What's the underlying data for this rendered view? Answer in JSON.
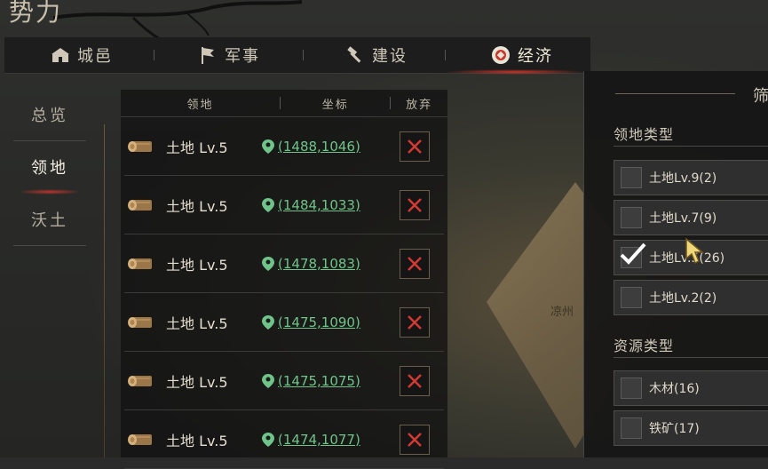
{
  "page_title": "势力",
  "tabs": [
    {
      "label": "城邑",
      "icon": "city-icon",
      "active": false
    },
    {
      "label": "军事",
      "icon": "flag-icon",
      "active": false
    },
    {
      "label": "建设",
      "icon": "hammer-icon",
      "active": false
    },
    {
      "label": "经济",
      "icon": "coin-icon",
      "active": true
    }
  ],
  "nav": [
    {
      "label": "总览",
      "active": false
    },
    {
      "label": "领地",
      "active": true
    },
    {
      "label": "沃土",
      "active": false
    }
  ],
  "table": {
    "headers": {
      "land": "领地",
      "coord": "坐标",
      "abandon": "放弃"
    },
    "rows": [
      {
        "name": "土地 Lv.5",
        "coord": "(1488,1046)"
      },
      {
        "name": "土地 Lv.5",
        "coord": "(1484,1033)"
      },
      {
        "name": "土地 Lv.5",
        "coord": "(1478,1083)"
      },
      {
        "name": "土地 Lv.5",
        "coord": "(1475,1090)"
      },
      {
        "name": "土地 Lv.5",
        "coord": "(1475,1075)"
      },
      {
        "name": "土地 Lv.5",
        "coord": "(1474,1077)"
      }
    ]
  },
  "map": {
    "label": "凉州"
  },
  "filter": {
    "title": "筛",
    "land_type_title": "领地类型",
    "land_options": [
      {
        "label": "土地Lv.9(2)",
        "checked": false
      },
      {
        "label": "土地Lv.7(9)",
        "checked": false
      },
      {
        "label": "土地Lv.5(26)",
        "checked": true
      },
      {
        "label": "土地Lv.2(2)",
        "checked": false
      }
    ],
    "resource_type_title": "资源类型",
    "resource_options": [
      {
        "label": "木材(16)",
        "checked": false
      },
      {
        "label": "铁矿(17)",
        "checked": false
      }
    ]
  },
  "colors": {
    "accent_red": "#c9362b",
    "coord_green": "#6fc489",
    "x_red": "#d23a32"
  }
}
